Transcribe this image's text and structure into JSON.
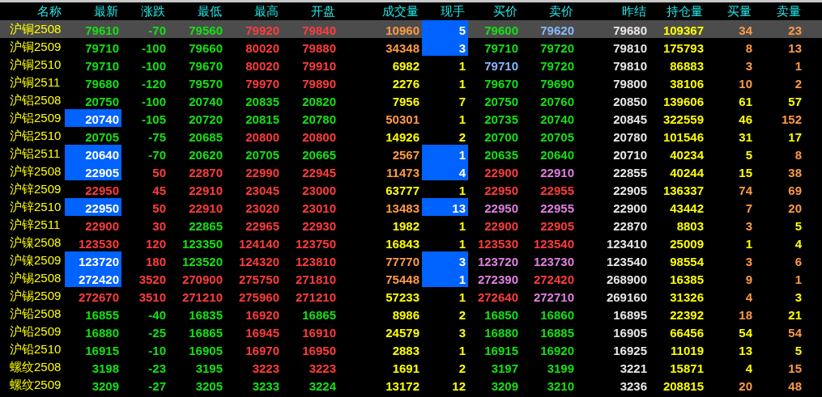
{
  "columns": [
    "名称",
    "最新",
    "涨跌",
    "最低",
    "最高",
    "开盘",
    "成交量",
    "现手",
    "买价",
    "卖价",
    "昨结",
    "持仓量",
    "买量",
    "卖量"
  ],
  "rows": [
    {
      "selected": true,
      "last_flash": false,
      "hand_flash": true,
      "name": "沪铜2508",
      "cells": [
        {
          "text": "79610",
          "color": "#14e014"
        },
        {
          "text": "-70",
          "color": "#14e014"
        },
        {
          "text": "79560",
          "color": "#14e014"
        },
        {
          "text": "79920",
          "color": "#ff3c3c"
        },
        {
          "text": "79840",
          "color": "#ff3c3c"
        },
        {
          "text": "10960",
          "color": "#ff9a46"
        },
        {
          "text": "5",
          "color": "#ffffff"
        },
        {
          "text": "79600",
          "color": "#14e014"
        },
        {
          "text": "79620",
          "color": "#88b8ff"
        },
        {
          "text": "79680",
          "color": "#e8e8e8"
        },
        {
          "text": "109367",
          "color": "#ffff00"
        },
        {
          "text": "34",
          "color": "#ff9a46"
        },
        {
          "text": "23",
          "color": "#ff9a46"
        }
      ]
    },
    {
      "selected": false,
      "last_flash": false,
      "hand_flash": true,
      "name": "沪铜2509",
      "cells": [
        {
          "text": "79710",
          "color": "#14e014"
        },
        {
          "text": "-100",
          "color": "#14e014"
        },
        {
          "text": "79660",
          "color": "#14e014"
        },
        {
          "text": "80020",
          "color": "#ff3c3c"
        },
        {
          "text": "79880",
          "color": "#ff3c3c"
        },
        {
          "text": "34348",
          "color": "#ff9a46"
        },
        {
          "text": "3",
          "color": "#ffffff"
        },
        {
          "text": "79710",
          "color": "#14e014"
        },
        {
          "text": "79720",
          "color": "#14e014"
        },
        {
          "text": "79810",
          "color": "#e8e8e8"
        },
        {
          "text": "175793",
          "color": "#ffff00"
        },
        {
          "text": "8",
          "color": "#ff9a46"
        },
        {
          "text": "13",
          "color": "#ff9a46"
        }
      ]
    },
    {
      "selected": false,
      "last_flash": false,
      "hand_flash": false,
      "name": "沪铜2510",
      "cells": [
        {
          "text": "79710",
          "color": "#14e014"
        },
        {
          "text": "-100",
          "color": "#14e014"
        },
        {
          "text": "79670",
          "color": "#14e014"
        },
        {
          "text": "80020",
          "color": "#ff3c3c"
        },
        {
          "text": "79910",
          "color": "#ff3c3c"
        },
        {
          "text": "6982",
          "color": "#ffff00"
        },
        {
          "text": "1",
          "color": "#ffff00"
        },
        {
          "text": "79710",
          "color": "#88b8ff"
        },
        {
          "text": "79720",
          "color": "#14e014"
        },
        {
          "text": "79810",
          "color": "#e8e8e8"
        },
        {
          "text": "86883",
          "color": "#ffff00"
        },
        {
          "text": "3",
          "color": "#ff9a46"
        },
        {
          "text": "1",
          "color": "#ff9a46"
        }
      ]
    },
    {
      "selected": false,
      "last_flash": false,
      "hand_flash": false,
      "name": "沪铜2511",
      "cells": [
        {
          "text": "79680",
          "color": "#14e014"
        },
        {
          "text": "-120",
          "color": "#14e014"
        },
        {
          "text": "79570",
          "color": "#14e014"
        },
        {
          "text": "79970",
          "color": "#ff3c3c"
        },
        {
          "text": "79890",
          "color": "#ff3c3c"
        },
        {
          "text": "2276",
          "color": "#ffff00"
        },
        {
          "text": "1",
          "color": "#ffff00"
        },
        {
          "text": "79670",
          "color": "#14e014"
        },
        {
          "text": "79690",
          "color": "#14e014"
        },
        {
          "text": "79800",
          "color": "#e8e8e8"
        },
        {
          "text": "38106",
          "color": "#ffff00"
        },
        {
          "text": "10",
          "color": "#ff9a46"
        },
        {
          "text": "2",
          "color": "#ff9a46"
        }
      ]
    },
    {
      "selected": false,
      "last_flash": false,
      "hand_flash": false,
      "name": "沪铝2508",
      "cells": [
        {
          "text": "20750",
          "color": "#14e014"
        },
        {
          "text": "-100",
          "color": "#14e014"
        },
        {
          "text": "20740",
          "color": "#14e014"
        },
        {
          "text": "20835",
          "color": "#14e014"
        },
        {
          "text": "20820",
          "color": "#14e014"
        },
        {
          "text": "7956",
          "color": "#ffff00"
        },
        {
          "text": "7",
          "color": "#ffff00"
        },
        {
          "text": "20750",
          "color": "#14e014"
        },
        {
          "text": "20760",
          "color": "#14e014"
        },
        {
          "text": "20850",
          "color": "#e8e8e8"
        },
        {
          "text": "139606",
          "color": "#ffff00"
        },
        {
          "text": "61",
          "color": "#ffff00"
        },
        {
          "text": "57",
          "color": "#ffff00"
        }
      ]
    },
    {
      "selected": false,
      "last_flash": true,
      "hand_flash": false,
      "name": "沪铝2509",
      "cells": [
        {
          "text": "20740",
          "color": "#ffffff"
        },
        {
          "text": "-105",
          "color": "#14e014"
        },
        {
          "text": "20720",
          "color": "#14e014"
        },
        {
          "text": "20815",
          "color": "#14e014"
        },
        {
          "text": "20780",
          "color": "#14e014"
        },
        {
          "text": "50301",
          "color": "#ff9a46"
        },
        {
          "text": "1",
          "color": "#ffff00"
        },
        {
          "text": "20735",
          "color": "#14e014"
        },
        {
          "text": "20740",
          "color": "#14e014"
        },
        {
          "text": "20845",
          "color": "#e8e8e8"
        },
        {
          "text": "322559",
          "color": "#ffff00"
        },
        {
          "text": "46",
          "color": "#ffff00"
        },
        {
          "text": "152",
          "color": "#ff9a46"
        }
      ]
    },
    {
      "selected": false,
      "last_flash": false,
      "hand_flash": false,
      "name": "沪铝2510",
      "cells": [
        {
          "text": "20705",
          "color": "#14e014"
        },
        {
          "text": "-75",
          "color": "#14e014"
        },
        {
          "text": "20685",
          "color": "#14e014"
        },
        {
          "text": "20800",
          "color": "#ff3c3c"
        },
        {
          "text": "20800",
          "color": "#ff3c3c"
        },
        {
          "text": "14926",
          "color": "#ffff00"
        },
        {
          "text": "2",
          "color": "#ffff00"
        },
        {
          "text": "20700",
          "color": "#14e014"
        },
        {
          "text": "20705",
          "color": "#14e014"
        },
        {
          "text": "20780",
          "color": "#e8e8e8"
        },
        {
          "text": "101546",
          "color": "#ffff00"
        },
        {
          "text": "31",
          "color": "#ffff00"
        },
        {
          "text": "17",
          "color": "#ffff00"
        }
      ]
    },
    {
      "selected": false,
      "last_flash": true,
      "hand_flash": true,
      "name": "沪铝2511",
      "cells": [
        {
          "text": "20640",
          "color": "#ffffff"
        },
        {
          "text": "-70",
          "color": "#14e014"
        },
        {
          "text": "20620",
          "color": "#14e014"
        },
        {
          "text": "20705",
          "color": "#14e014"
        },
        {
          "text": "20665",
          "color": "#14e014"
        },
        {
          "text": "2567",
          "color": "#ff9a46"
        },
        {
          "text": "1",
          "color": "#ffffff"
        },
        {
          "text": "20635",
          "color": "#14e014"
        },
        {
          "text": "20640",
          "color": "#14e014"
        },
        {
          "text": "20710",
          "color": "#e8e8e8"
        },
        {
          "text": "40234",
          "color": "#ffff00"
        },
        {
          "text": "5",
          "color": "#ffff00"
        },
        {
          "text": "8",
          "color": "#ff9a46"
        }
      ]
    },
    {
      "selected": false,
      "last_flash": true,
      "hand_flash": true,
      "name": "沪锌2508",
      "cells": [
        {
          "text": "22905",
          "color": "#ffffff"
        },
        {
          "text": "50",
          "color": "#ff3c3c"
        },
        {
          "text": "22870",
          "color": "#ff3c3c"
        },
        {
          "text": "22990",
          "color": "#ff3c3c"
        },
        {
          "text": "22945",
          "color": "#ff3c3c"
        },
        {
          "text": "11473",
          "color": "#ff9a46"
        },
        {
          "text": "4",
          "color": "#ffffff"
        },
        {
          "text": "22900",
          "color": "#ff3c3c"
        },
        {
          "text": "22910",
          "color": "#e080e0"
        },
        {
          "text": "22855",
          "color": "#e8e8e8"
        },
        {
          "text": "40244",
          "color": "#ffff00"
        },
        {
          "text": "15",
          "color": "#ffff00"
        },
        {
          "text": "38",
          "color": "#ff9a46"
        }
      ]
    },
    {
      "selected": false,
      "last_flash": false,
      "hand_flash": false,
      "name": "沪锌2509",
      "cells": [
        {
          "text": "22950",
          "color": "#ff3c3c"
        },
        {
          "text": "45",
          "color": "#ff3c3c"
        },
        {
          "text": "22910",
          "color": "#ff3c3c"
        },
        {
          "text": "23045",
          "color": "#ff3c3c"
        },
        {
          "text": "23000",
          "color": "#ff3c3c"
        },
        {
          "text": "63777",
          "color": "#ffff00"
        },
        {
          "text": "1",
          "color": "#ffff00"
        },
        {
          "text": "22950",
          "color": "#ff3c3c"
        },
        {
          "text": "22955",
          "color": "#ff3c3c"
        },
        {
          "text": "22905",
          "color": "#e8e8e8"
        },
        {
          "text": "136337",
          "color": "#ffff00"
        },
        {
          "text": "74",
          "color": "#ff9a46"
        },
        {
          "text": "69",
          "color": "#ff9a46"
        }
      ]
    },
    {
      "selected": false,
      "last_flash": true,
      "hand_flash": true,
      "name": "沪锌2510",
      "cells": [
        {
          "text": "22950",
          "color": "#ffffff"
        },
        {
          "text": "50",
          "color": "#ff3c3c"
        },
        {
          "text": "22910",
          "color": "#ff3c3c"
        },
        {
          "text": "23020",
          "color": "#ff3c3c"
        },
        {
          "text": "23010",
          "color": "#ff3c3c"
        },
        {
          "text": "13483",
          "color": "#ff9a46"
        },
        {
          "text": "13",
          "color": "#ffffff"
        },
        {
          "text": "22950",
          "color": "#e080e0"
        },
        {
          "text": "22955",
          "color": "#e080e0"
        },
        {
          "text": "22900",
          "color": "#e8e8e8"
        },
        {
          "text": "43442",
          "color": "#ffff00"
        },
        {
          "text": "7",
          "color": "#ff9a46"
        },
        {
          "text": "20",
          "color": "#ff9a46"
        }
      ]
    },
    {
      "selected": false,
      "last_flash": false,
      "hand_flash": false,
      "name": "沪锌2511",
      "cells": [
        {
          "text": "22900",
          "color": "#ff3c3c"
        },
        {
          "text": "30",
          "color": "#ff3c3c"
        },
        {
          "text": "22865",
          "color": "#14e014"
        },
        {
          "text": "22965",
          "color": "#ff3c3c"
        },
        {
          "text": "22930",
          "color": "#ff3c3c"
        },
        {
          "text": "1982",
          "color": "#ffff00"
        },
        {
          "text": "1",
          "color": "#ffff00"
        },
        {
          "text": "22900",
          "color": "#ff3c3c"
        },
        {
          "text": "22905",
          "color": "#ff3c3c"
        },
        {
          "text": "22870",
          "color": "#e8e8e8"
        },
        {
          "text": "8803",
          "color": "#ffff00"
        },
        {
          "text": "3",
          "color": "#ff9a46"
        },
        {
          "text": "5",
          "color": "#ffff00"
        }
      ]
    },
    {
      "selected": false,
      "last_flash": false,
      "hand_flash": false,
      "name": "沪镍2508",
      "cells": [
        {
          "text": "123530",
          "color": "#ff3c3c"
        },
        {
          "text": "120",
          "color": "#ff3c3c"
        },
        {
          "text": "123350",
          "color": "#14e014"
        },
        {
          "text": "124140",
          "color": "#ff3c3c"
        },
        {
          "text": "123750",
          "color": "#ff3c3c"
        },
        {
          "text": "16843",
          "color": "#ffff00"
        },
        {
          "text": "1",
          "color": "#ffff00"
        },
        {
          "text": "123530",
          "color": "#ff3c3c"
        },
        {
          "text": "123540",
          "color": "#ff3c3c"
        },
        {
          "text": "123410",
          "color": "#e8e8e8"
        },
        {
          "text": "25009",
          "color": "#ffff00"
        },
        {
          "text": "1",
          "color": "#ffff00"
        },
        {
          "text": "4",
          "color": "#ffff00"
        }
      ]
    },
    {
      "selected": false,
      "last_flash": true,
      "hand_flash": true,
      "name": "沪镍2509",
      "cells": [
        {
          "text": "123720",
          "color": "#ffffff"
        },
        {
          "text": "180",
          "color": "#ff3c3c"
        },
        {
          "text": "123520",
          "color": "#14e014"
        },
        {
          "text": "124320",
          "color": "#ff3c3c"
        },
        {
          "text": "123810",
          "color": "#ff3c3c"
        },
        {
          "text": "77770",
          "color": "#ff9a46"
        },
        {
          "text": "3",
          "color": "#ffffff"
        },
        {
          "text": "123720",
          "color": "#e080e0"
        },
        {
          "text": "123730",
          "color": "#e080e0"
        },
        {
          "text": "123540",
          "color": "#e8e8e8"
        },
        {
          "text": "98554",
          "color": "#ffff00"
        },
        {
          "text": "3",
          "color": "#ff9a46"
        },
        {
          "text": "6",
          "color": "#ff9a46"
        }
      ]
    },
    {
      "selected": false,
      "last_flash": true,
      "hand_flash": true,
      "name": "沪锡2508",
      "cells": [
        {
          "text": "272420",
          "color": "#ffffff"
        },
        {
          "text": "3520",
          "color": "#ff3c3c"
        },
        {
          "text": "270900",
          "color": "#ff3c3c"
        },
        {
          "text": "275750",
          "color": "#ff3c3c"
        },
        {
          "text": "271810",
          "color": "#ff3c3c"
        },
        {
          "text": "75448",
          "color": "#ff9a46"
        },
        {
          "text": "1",
          "color": "#ffffff"
        },
        {
          "text": "272390",
          "color": "#e080e0"
        },
        {
          "text": "272420",
          "color": "#ff3c3c"
        },
        {
          "text": "268900",
          "color": "#e8e8e8"
        },
        {
          "text": "16385",
          "color": "#ffff00"
        },
        {
          "text": "9",
          "color": "#ff9a46"
        },
        {
          "text": "1",
          "color": "#ff9a46"
        }
      ]
    },
    {
      "selected": false,
      "last_flash": false,
      "hand_flash": false,
      "name": "沪锡2509",
      "cells": [
        {
          "text": "272670",
          "color": "#ff3c3c"
        },
        {
          "text": "3510",
          "color": "#ff3c3c"
        },
        {
          "text": "271210",
          "color": "#ff3c3c"
        },
        {
          "text": "275960",
          "color": "#ff3c3c"
        },
        {
          "text": "271210",
          "color": "#ff3c3c"
        },
        {
          "text": "57233",
          "color": "#ffff00"
        },
        {
          "text": "1",
          "color": "#ffff00"
        },
        {
          "text": "272640",
          "color": "#ff3c3c"
        },
        {
          "text": "272710",
          "color": "#e080e0"
        },
        {
          "text": "269160",
          "color": "#e8e8e8"
        },
        {
          "text": "31326",
          "color": "#ffff00"
        },
        {
          "text": "4",
          "color": "#ff9a46"
        },
        {
          "text": "3",
          "color": "#ffff00"
        }
      ]
    },
    {
      "selected": false,
      "last_flash": false,
      "hand_flash": false,
      "name": "沪铅2508",
      "cells": [
        {
          "text": "16855",
          "color": "#14e014"
        },
        {
          "text": "-40",
          "color": "#14e014"
        },
        {
          "text": "16835",
          "color": "#14e014"
        },
        {
          "text": "16920",
          "color": "#ff3c3c"
        },
        {
          "text": "16865",
          "color": "#14e014"
        },
        {
          "text": "8986",
          "color": "#ffff00"
        },
        {
          "text": "2",
          "color": "#ffff00"
        },
        {
          "text": "16850",
          "color": "#14e014"
        },
        {
          "text": "16860",
          "color": "#14e014"
        },
        {
          "text": "16895",
          "color": "#e8e8e8"
        },
        {
          "text": "22392",
          "color": "#ffff00"
        },
        {
          "text": "18",
          "color": "#ff9a46"
        },
        {
          "text": "21",
          "color": "#ffff00"
        }
      ]
    },
    {
      "selected": false,
      "last_flash": false,
      "hand_flash": false,
      "name": "沪铅2509",
      "cells": [
        {
          "text": "16880",
          "color": "#14e014"
        },
        {
          "text": "-25",
          "color": "#14e014"
        },
        {
          "text": "16865",
          "color": "#14e014"
        },
        {
          "text": "16945",
          "color": "#ff3c3c"
        },
        {
          "text": "16910",
          "color": "#ff3c3c"
        },
        {
          "text": "24579",
          "color": "#ffff00"
        },
        {
          "text": "3",
          "color": "#ffff00"
        },
        {
          "text": "16880",
          "color": "#14e014"
        },
        {
          "text": "16885",
          "color": "#14e014"
        },
        {
          "text": "16905",
          "color": "#e8e8e8"
        },
        {
          "text": "66456",
          "color": "#ffff00"
        },
        {
          "text": "54",
          "color": "#ffff00"
        },
        {
          "text": "54",
          "color": "#ff9a46"
        }
      ]
    },
    {
      "selected": false,
      "last_flash": false,
      "hand_flash": false,
      "name": "沪铅2510",
      "cells": [
        {
          "text": "16915",
          "color": "#14e014"
        },
        {
          "text": "-10",
          "color": "#14e014"
        },
        {
          "text": "16905",
          "color": "#14e014"
        },
        {
          "text": "16970",
          "color": "#ff3c3c"
        },
        {
          "text": "16950",
          "color": "#ff3c3c"
        },
        {
          "text": "2883",
          "color": "#ffff00"
        },
        {
          "text": "1",
          "color": "#ffff00"
        },
        {
          "text": "16915",
          "color": "#14e014"
        },
        {
          "text": "16920",
          "color": "#14e014"
        },
        {
          "text": "16925",
          "color": "#e8e8e8"
        },
        {
          "text": "11019",
          "color": "#ffff00"
        },
        {
          "text": "13",
          "color": "#ffff00"
        },
        {
          "text": "5",
          "color": "#ffff00"
        }
      ]
    },
    {
      "selected": false,
      "last_flash": false,
      "hand_flash": false,
      "name": "螺纹2508",
      "cells": [
        {
          "text": "3198",
          "color": "#14e014"
        },
        {
          "text": "-23",
          "color": "#14e014"
        },
        {
          "text": "3195",
          "color": "#14e014"
        },
        {
          "text": "3223",
          "color": "#ff3c3c"
        },
        {
          "text": "3223",
          "color": "#ff3c3c"
        },
        {
          "text": "1691",
          "color": "#ffff00"
        },
        {
          "text": "2",
          "color": "#ffff00"
        },
        {
          "text": "3197",
          "color": "#14e014"
        },
        {
          "text": "3199",
          "color": "#14e014"
        },
        {
          "text": "3221",
          "color": "#e8e8e8"
        },
        {
          "text": "15871",
          "color": "#ffff00"
        },
        {
          "text": "4",
          "color": "#ffff00"
        },
        {
          "text": "15",
          "color": "#ff9a46"
        }
      ]
    },
    {
      "selected": false,
      "last_flash": false,
      "hand_flash": false,
      "name": "螺纹2509",
      "cells": [
        {
          "text": "3209",
          "color": "#14e014"
        },
        {
          "text": "-27",
          "color": "#14e014"
        },
        {
          "text": "3205",
          "color": "#14e014"
        },
        {
          "text": "3233",
          "color": "#14e014"
        },
        {
          "text": "3224",
          "color": "#14e014"
        },
        {
          "text": "13172",
          "color": "#ffff00"
        },
        {
          "text": "12",
          "color": "#ffff00"
        },
        {
          "text": "3209",
          "color": "#14e014"
        },
        {
          "text": "3210",
          "color": "#14e014"
        },
        {
          "text": "3236",
          "color": "#e8e8e8"
        },
        {
          "text": "208815",
          "color": "#ffff00"
        },
        {
          "text": "20",
          "color": "#ff9a46"
        },
        {
          "text": "48",
          "color": "#ff9a46"
        }
      ]
    }
  ]
}
